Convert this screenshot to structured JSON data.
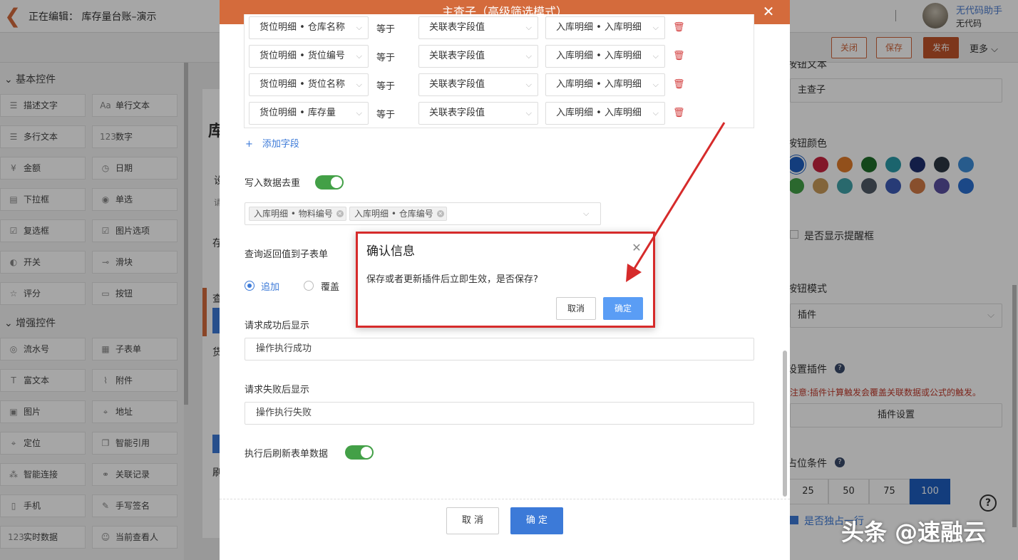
{
  "topbar": {
    "back": "❮",
    "editing_title": "正在编辑： 库存量台账–演示",
    "user_name": "无代码助手",
    "user_sub": "无代码"
  },
  "toolbar": {
    "close": "关闭",
    "save": "保存",
    "publish": "发布",
    "more": "更多 ⌵"
  },
  "left": {
    "basic_title": "⌄ 基本控件",
    "enhanced_title": "⌄ 增强控件",
    "basic": [
      {
        "label": "描述文字",
        "icon": "☰"
      },
      {
        "label": "单行文本",
        "icon": "Aa"
      },
      {
        "label": "多行文本",
        "icon": "☰"
      },
      {
        "label": "数字",
        "icon": "123"
      },
      {
        "label": "金额",
        "icon": "¥"
      },
      {
        "label": "日期",
        "icon": "◷"
      },
      {
        "label": "下拉框",
        "icon": "▤"
      },
      {
        "label": "单选",
        "icon": "◉"
      },
      {
        "label": "复选框",
        "icon": "☑"
      },
      {
        "label": "图片选项",
        "icon": "☑"
      },
      {
        "label": "开关",
        "icon": "◐"
      },
      {
        "label": "滑块",
        "icon": "⊸"
      },
      {
        "label": "评分",
        "icon": "☆"
      },
      {
        "label": "按钮",
        "icon": "▭"
      }
    ],
    "enhanced": [
      {
        "label": "流水号",
        "icon": "◎"
      },
      {
        "label": "子表单",
        "icon": "▦"
      },
      {
        "label": "富文本",
        "icon": "T"
      },
      {
        "label": "附件",
        "icon": "⌇"
      },
      {
        "label": "图片",
        "icon": "▣"
      },
      {
        "label": "地址",
        "icon": "⌖"
      },
      {
        "label": "定位",
        "icon": "⌖"
      },
      {
        "label": "智能引用",
        "icon": "❐"
      },
      {
        "label": "智能连接",
        "icon": "⁂"
      },
      {
        "label": "关联记录",
        "icon": "⚭"
      },
      {
        "label": "手机",
        "icon": "▯"
      },
      {
        "label": "手写签名",
        "icon": "✎"
      },
      {
        "label": "实时数据",
        "icon": "123"
      },
      {
        "label": "当前查看人",
        "icon": "☺"
      }
    ]
  },
  "middle": {
    "t1": "库",
    "t2": "设",
    "t3": "请",
    "t4": "存",
    "t5": "查",
    "t6": "货",
    "t7": "刷"
  },
  "right": {
    "btn_text_label": "按钮文本",
    "btn_text_value": "主查子",
    "btn_color_label": "按钮颜色",
    "colors_row1": [
      "#1e5fc0",
      "#c8243f",
      "#e07b2a",
      "#1f6e2a",
      "#2a9aa8",
      "#1e2f6e",
      "#2b3742",
      "#3c8dd8"
    ],
    "colors_row2": [
      "#43a047",
      "#c89a5a",
      "#3fa2a8",
      "#4f5a66",
      "#3d5bb5",
      "#d27a45",
      "#5a4fa0",
      "#2a6fd0"
    ],
    "show_alert_label": "是否显示提醒框",
    "btn_mode_label": "按钮模式",
    "btn_mode_value": "插件",
    "plugin_label": "设置插件",
    "plugin_note": "注意:插件计算触发会覆盖关联数据或公式的触发。",
    "plugin_btn": "插件设置",
    "position_label": "占位条件",
    "positions": [
      "25",
      "50",
      "75",
      "100"
    ],
    "exclusive_label": "是否独占一行"
  },
  "modal": {
    "title": "主查子（高级筛选模式）",
    "close": "✕",
    "rows": [
      {
        "field": "货位明细 • 仓库名称",
        "op": "等于",
        "type": "关联表字段值",
        "value": "入库明细 • 入库明细"
      },
      {
        "field": "货位明细 • 货位编号",
        "op": "等于",
        "type": "关联表字段值",
        "value": "入库明细 • 入库明细"
      },
      {
        "field": "货位明细 • 货位名称",
        "op": "等于",
        "type": "关联表字段值",
        "value": "入库明细 • 入库明细"
      },
      {
        "field": "货位明细 • 库存量",
        "op": "等于",
        "type": "关联表字段值",
        "value": "入库明细 • 入库明细"
      }
    ],
    "add_field": "+　添加字段",
    "dedup_label": "写入数据去重",
    "tags": [
      "入库明细 • 物料编号",
      "入库明细 • 仓库编号"
    ],
    "return_label": "查询返回值到子表单",
    "append": "追加",
    "overwrite": "覆盖",
    "success_label": "请求成功后显示",
    "success_value": "操作执行成功",
    "fail_label": "请求失败后显示",
    "fail_value": "操作执行失败",
    "refresh_label": "执行后刷新表单数据",
    "cancel": "取 消",
    "ok": "确 定"
  },
  "confirm": {
    "title": "确认信息",
    "close": "✕",
    "message": "保存或者更新插件后立即生效，是否保存?",
    "cancel": "取消",
    "ok": "确定"
  },
  "watermark": "头条 @速融云"
}
